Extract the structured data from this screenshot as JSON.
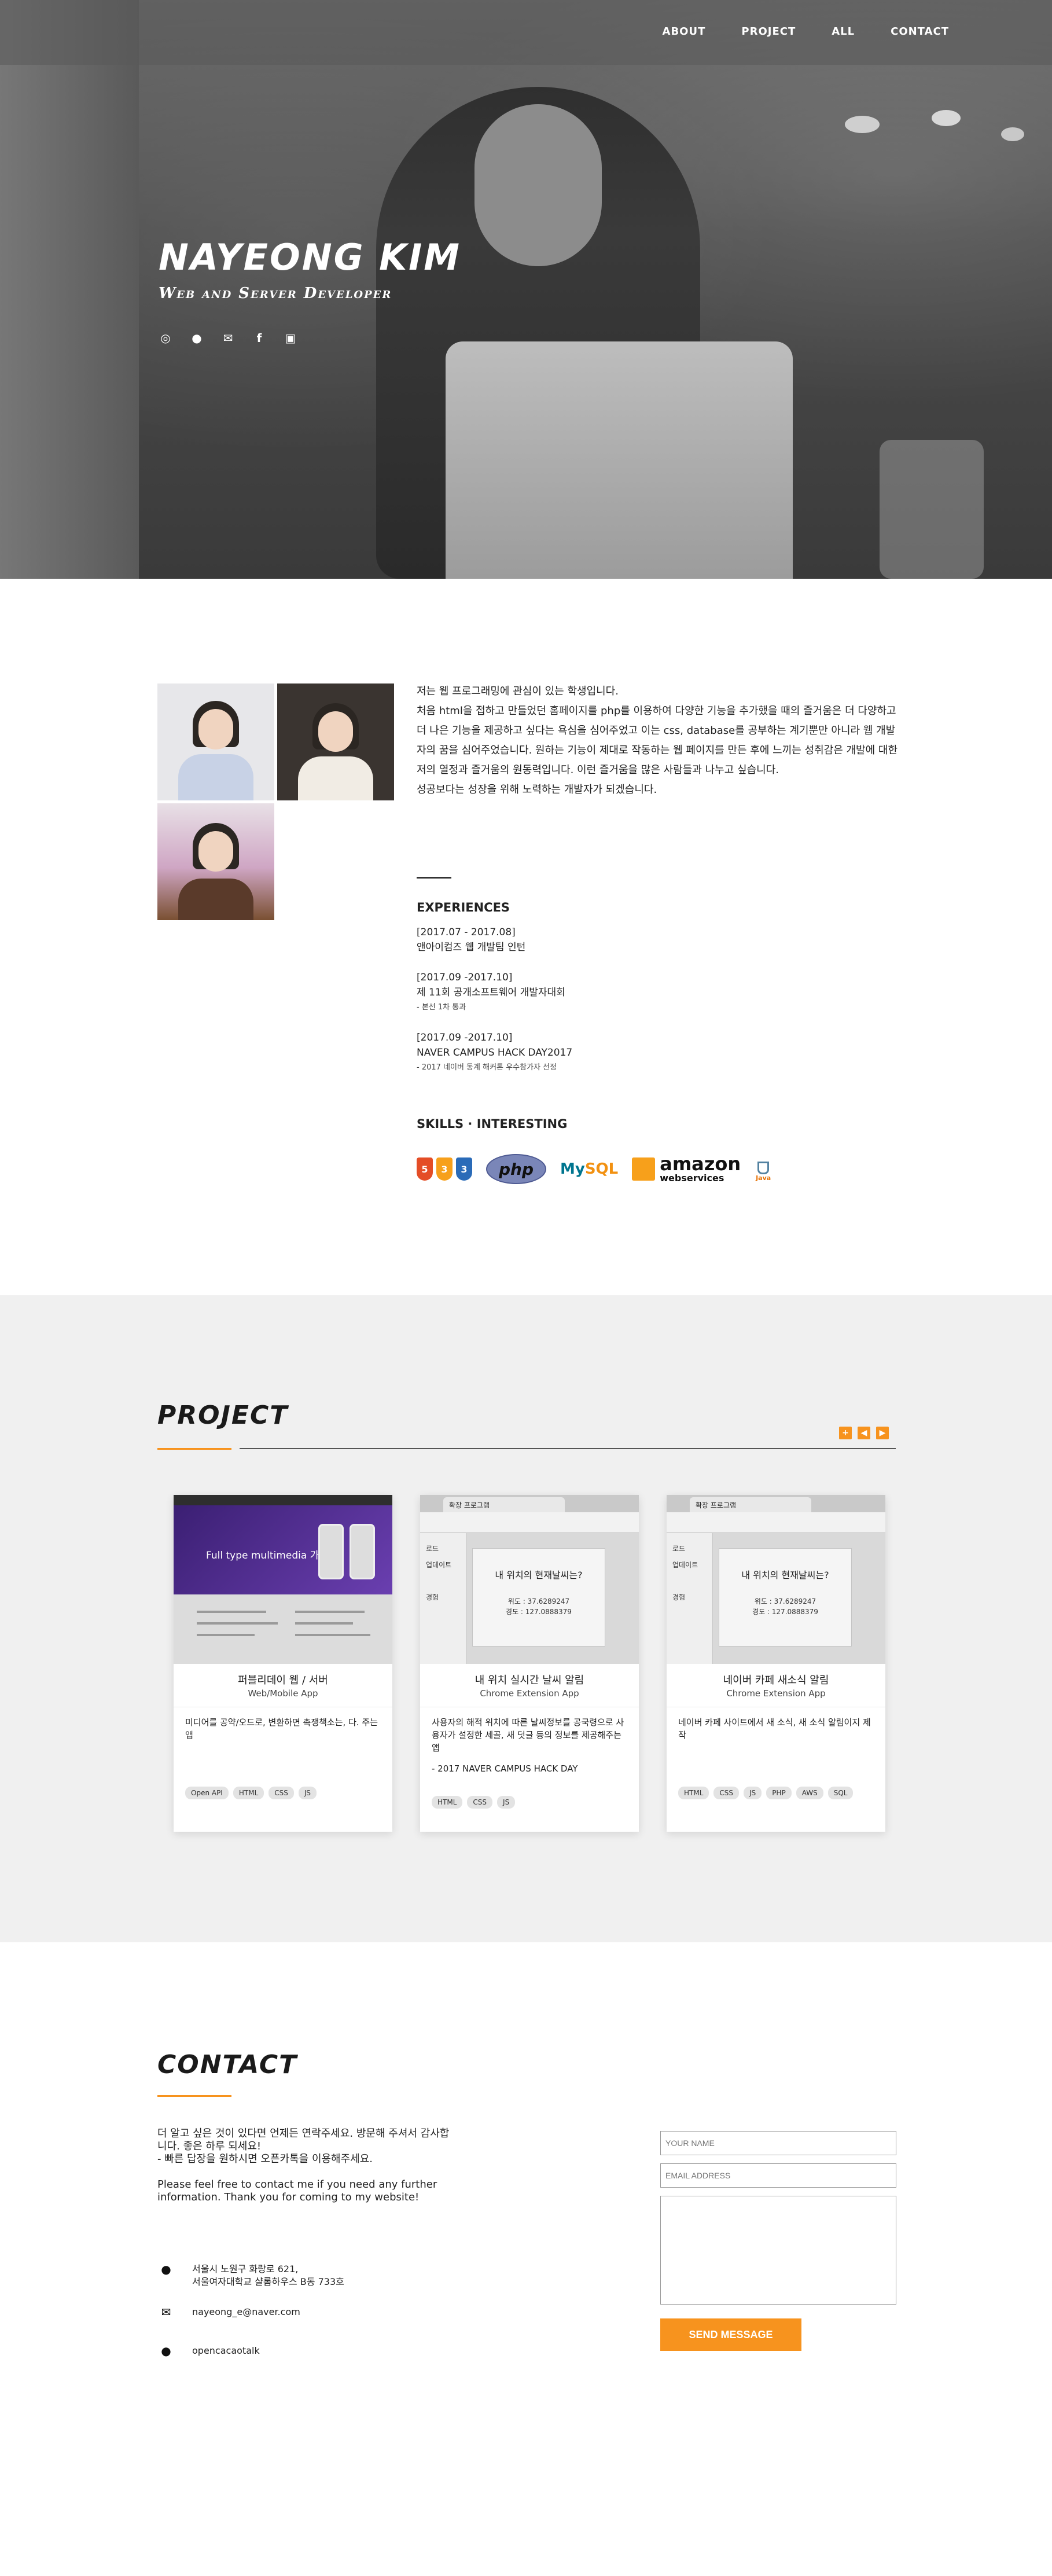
{
  "nav": {
    "items": [
      "ABOUT",
      "PROJECT",
      "ALL",
      "CONTACT"
    ]
  },
  "hero": {
    "name": "NAYEONG KIM",
    "subtitle": "Web and Server Developer",
    "social_icons": [
      "github-icon",
      "chat-icon",
      "mail-icon",
      "facebook-icon",
      "instagram-icon"
    ]
  },
  "about": {
    "paragraphs": [
      "저는 웹 프로그래밍에 관심이 있는 학생입니다.",
      "처음 html을 접하고 만들었던 홈페이지를 php를 이용하여 다양한 기능을 추가했을 때의 즐거움은 더 다양하고 더 나은 기능을 제공하고 싶다는 욕심을 심어주었고 이는 css, database를 공부하는 계기뿐만 아니라 웹 개발자의 꿈을 심어주었습니다. 원하는 기능이 제대로 작동하는 웹 페이지를 만든 후에 느끼는 성취감은 개발에 대한 저의 열정과 즐거움의 원동력입니다. 이런 즐거움을 많은 사람들과 나누고 싶습니다.",
      "성공보다는 성장을 위해 노력하는 개발자가 되겠습니다."
    ],
    "experiences_title": "EXPERIENCES",
    "experiences": [
      {
        "date": "[2017.07 - 2017.08]",
        "title": "앤아이컴즈 웹 개발팀 인턴",
        "note": ""
      },
      {
        "date": "[2017.09 -2017.10]",
        "title": "제 11회 공개소프트웨어 개발자대회",
        "note": "- 본선 1차 통과"
      },
      {
        "date": "[2017.09 -2017.10]",
        "title": "NAVER CAMPUS HACK DAY2017",
        "note": "- 2017 네이버 동계 해커톤 우수참가자 선정"
      }
    ],
    "skills_title": "SKILLS · INTERESTING",
    "skills": {
      "web_badges": [
        "5",
        "3",
        "3"
      ],
      "php": "php",
      "mysql_a": "My",
      "mysql_b": "SQL",
      "aws_a": "amazon",
      "aws_b": "webservices",
      "java": "Java"
    }
  },
  "project": {
    "title": "PROJECT",
    "arrows": [
      "+",
      "◀",
      "▶"
    ],
    "cards": [
      {
        "thumb_caption": "Full type multimedia 가족",
        "title": "퍼블리데이 웹 / 서버",
        "subtitle": "Web/Mobile App",
        "desc": "미디어를 공약/오드로, 변환하면 촉쟁책소는, 다. 주는 앱",
        "extra": "",
        "tags": [
          "Open API",
          "HTML",
          "CSS",
          "JS"
        ]
      },
      {
        "thumb_tab": "확장 프로그램",
        "thumb_question": "내 위치의 현재날씨는?",
        "thumb_lat": "위도 : 37.6289247",
        "thumb_lng": "경도 : 127.0888379",
        "thumb_side": [
          "로드",
          "업데이트",
          "경험"
        ],
        "title": "내 위치 실시간 날씨 알림",
        "subtitle": "Chrome Extension App",
        "desc": "사용자의 해적 위치에 따른 날씨정보를 공국령으로 사용자가 설정한 세골, 새 덧글 등의 정보를 제공해주는 앱",
        "extra": "- 2017 NAVER CAMPUS HACK DAY",
        "tags": [
          "HTML",
          "CSS",
          "JS"
        ]
      },
      {
        "thumb_tab": "확장 프로그램",
        "thumb_question": "내 위치의 현재날씨는?",
        "thumb_lat": "위도 : 37.6289247",
        "thumb_lng": "경도 : 127.0888379",
        "thumb_side": [
          "로드",
          "업데이트",
          "경험"
        ],
        "title": "네이버 카페 새소식 알림",
        "subtitle": "Chrome Extension App",
        "desc": "네이버 카페 사이트에서 새 소식, 새 소식 알림이지 제작",
        "extra": "",
        "tags": [
          "HTML",
          "CSS",
          "JS",
          "PHP",
          "AWS",
          "SQL"
        ]
      }
    ]
  },
  "contact": {
    "title": "CONTACT",
    "text_ko": "더 알고 싶은 것이 있다면 언제든 연락주세요. 방문해 주셔서 감사합니다. 좋은 하루 되세요!",
    "text_ko2": "- 빠른 답장을 원하시면 오픈카톡을 이용해주세요.",
    "text_en": "Please feel free to contact me if you need any further information. Thank you for coming to my website!",
    "address_1": "서울시 노원구 화랑로 621,",
    "address_2": "서울여자대학교 샬롬하우스 B동 733호",
    "email": "nayeong_e@naver.com",
    "kakao": "opencacaotalk",
    "form": {
      "name_placeholder": "YOUR NAME",
      "email_placeholder": "EMAIL ADDRESS",
      "message_placeholder": "",
      "send_label": "SEND MESSAGE"
    }
  },
  "colors": {
    "accent": "#f7931e",
    "project_bg": "#f0f0f0"
  }
}
